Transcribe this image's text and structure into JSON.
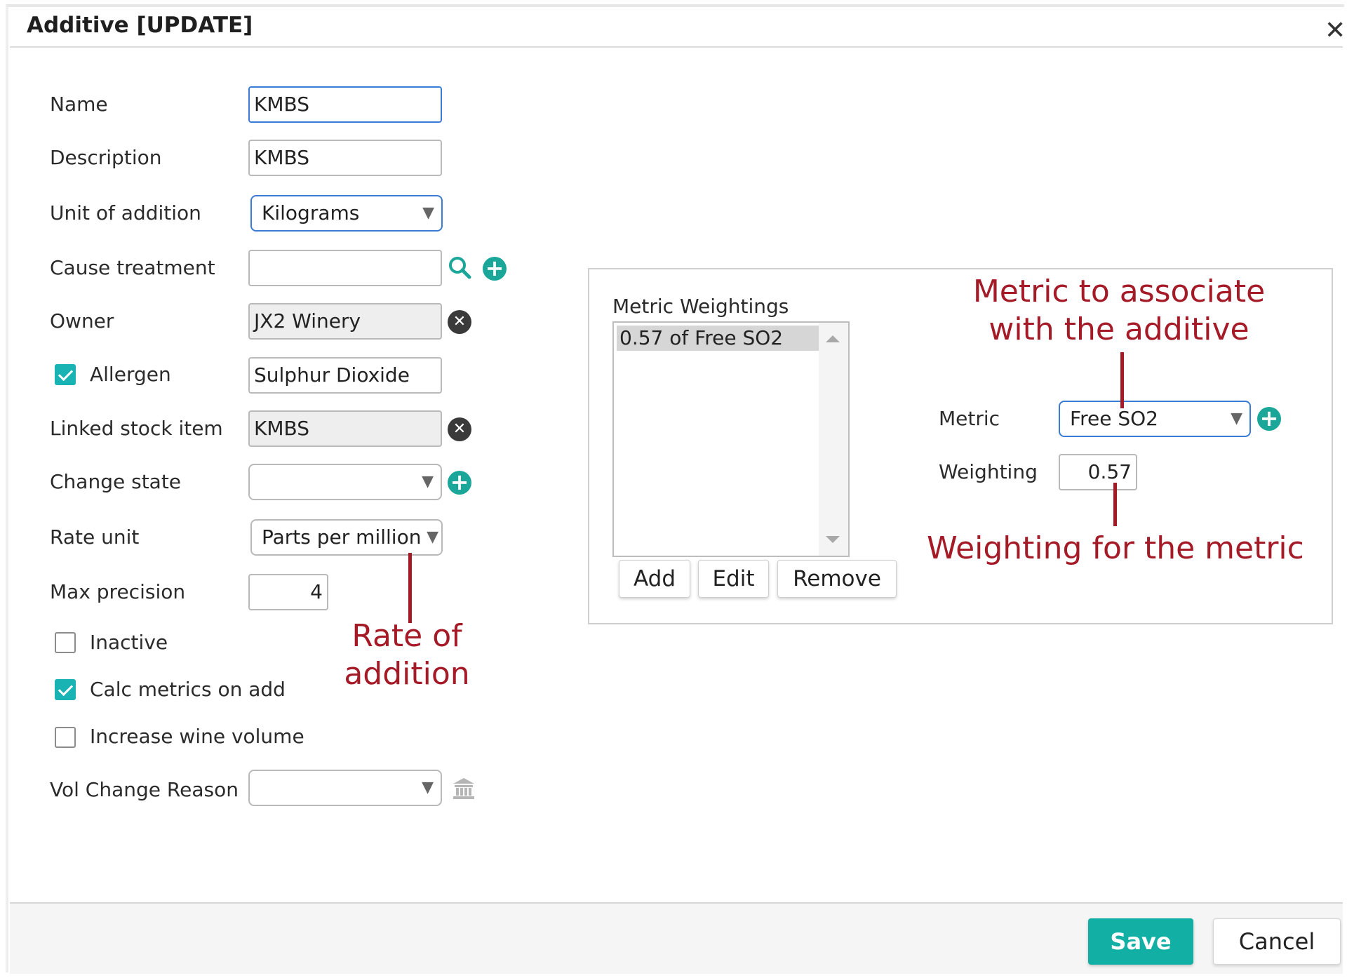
{
  "dialog": {
    "title": "Additive [UPDATE]",
    "close_symbol": "✕"
  },
  "form": {
    "name": {
      "label": "Name",
      "value": "KMBS"
    },
    "description": {
      "label": "Description",
      "value": "KMBS"
    },
    "unit_of_addition": {
      "label": "Unit of addition",
      "value": "Kilograms"
    },
    "cause_treatment": {
      "label": "Cause treatment",
      "value": ""
    },
    "owner": {
      "label": "Owner",
      "value": "JX2 Winery"
    },
    "allergen": {
      "label": "Allergen",
      "checked": true,
      "value": "Sulphur Dioxide"
    },
    "linked_stock_item": {
      "label": "Linked stock item",
      "value": "KMBS"
    },
    "change_state": {
      "label": "Change state",
      "value": ""
    },
    "rate_unit": {
      "label": "Rate unit",
      "value": "Parts per million"
    },
    "max_precision": {
      "label": "Max precision",
      "value": "4"
    },
    "inactive": {
      "label": "Inactive",
      "checked": false
    },
    "calc_metrics_on_add": {
      "label": "Calc metrics on add",
      "checked": true
    },
    "increase_wine_volume": {
      "label": "Increase wine volume",
      "checked": false
    },
    "vol_change_reason": {
      "label": "Vol Change Reason",
      "value": ""
    }
  },
  "metric_weightings": {
    "title": "Metric Weightings",
    "items": [
      "0.57 of Free SO2"
    ],
    "buttons": {
      "add": "Add",
      "edit": "Edit",
      "remove": "Remove"
    },
    "metric": {
      "label": "Metric",
      "value": "Free SO2"
    },
    "weighting": {
      "label": "Weighting",
      "value": "0.57"
    }
  },
  "annotations": {
    "rate_of_addition": "Rate of addition",
    "metric_to_associate": "Metric to associate with the additive",
    "weighting_for_metric": "Weighting for the metric"
  },
  "footer": {
    "save": "Save",
    "cancel": "Cancel"
  },
  "icons": {
    "dropdown_arrow": "▼",
    "plus": "+",
    "clear": "✕"
  },
  "colors": {
    "accent": "#12b0a4",
    "annotation": "#a51a27",
    "focus_border": "#3a7bd5"
  }
}
